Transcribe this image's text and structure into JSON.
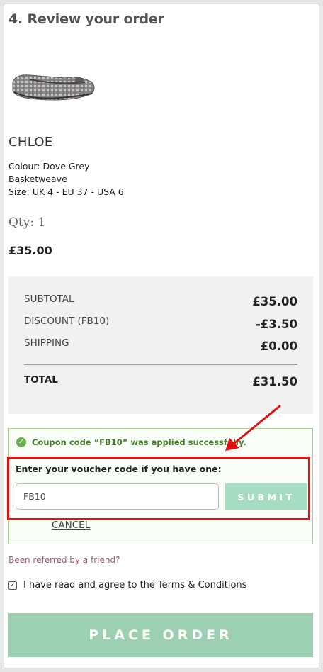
{
  "section": {
    "title": "4. Review your order"
  },
  "product": {
    "image_icon": "shoe-icon",
    "name": "CHLOE",
    "colour": "Colour: Dove Grey",
    "material": "Basketweave",
    "size": "Size: UK 4 - EU 37 - USA 6",
    "qty": "Qty: 1",
    "price": "£35.00"
  },
  "summary": {
    "subtotal_label": "SUBTOTAL",
    "subtotal_value": "£35.00",
    "discount_label": "DISCOUNT (FB10)",
    "discount_value": "-£3.50",
    "shipping_label": "SHIPPING",
    "shipping_value": "£0.00",
    "total_label": "TOTAL",
    "total_value": "£31.50"
  },
  "coupon": {
    "success_message": "Coupon code “FB10” was applied successfully.",
    "voucher_label": "Enter your voucher code if you have one:",
    "voucher_value": "FB10",
    "submit_label": "SUBMIT",
    "cancel_label": "CANCEL"
  },
  "referral_link": "Been referred by a friend?",
  "terms": {
    "text": "I have read and agree to the",
    "link": "Terms & Conditions",
    "checked": true
  },
  "place_order_label": "PLACE ORDER",
  "colors": {
    "accent_green": "#9dd0b3",
    "highlight_red": "#e01111",
    "success_green": "#4a7b2e"
  }
}
